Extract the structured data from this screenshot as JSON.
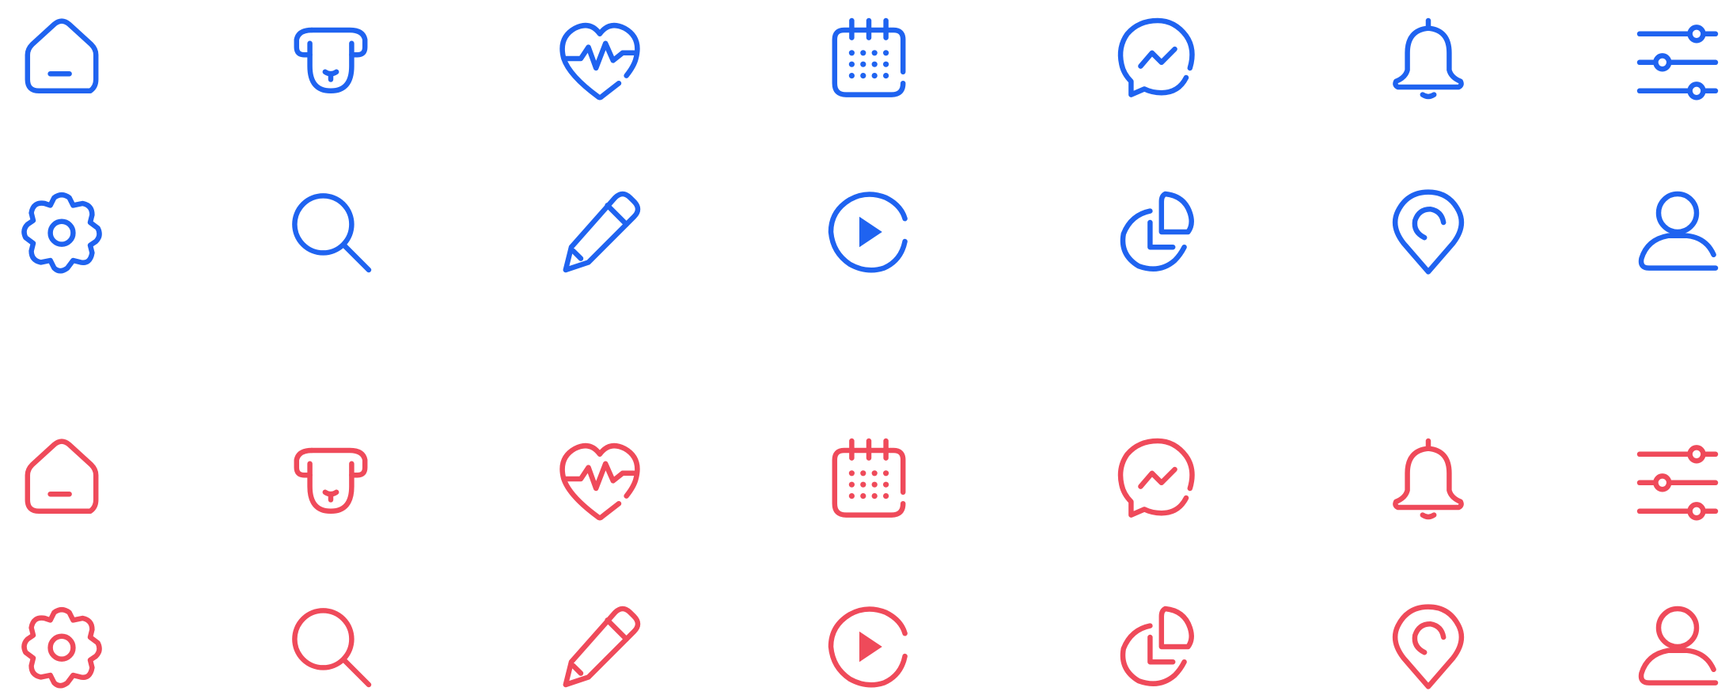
{
  "colors": {
    "blue": "#1f63f0",
    "red": "#ef4a5a"
  },
  "icon_sets": [
    {
      "name": "blue-set",
      "color": "#1f63f0",
      "rows": [
        [
          "home-icon",
          "dog-icon",
          "heart-pulse-icon",
          "calendar-icon",
          "messenger-icon",
          "bell-icon",
          "sliders-icon"
        ],
        [
          "gear-icon",
          "search-icon",
          "pencil-icon",
          "play-circle-icon",
          "pie-chart-icon",
          "location-pin-icon",
          "user-icon"
        ]
      ]
    },
    {
      "name": "red-set",
      "color": "#ef4a5a",
      "rows": [
        [
          "home-icon",
          "dog-icon",
          "heart-pulse-icon",
          "calendar-icon",
          "messenger-icon",
          "bell-icon",
          "sliders-icon"
        ],
        [
          "gear-icon",
          "search-icon",
          "pencil-icon",
          "play-circle-icon",
          "pie-chart-icon",
          "location-pin-icon",
          "user-icon"
        ]
      ]
    }
  ]
}
